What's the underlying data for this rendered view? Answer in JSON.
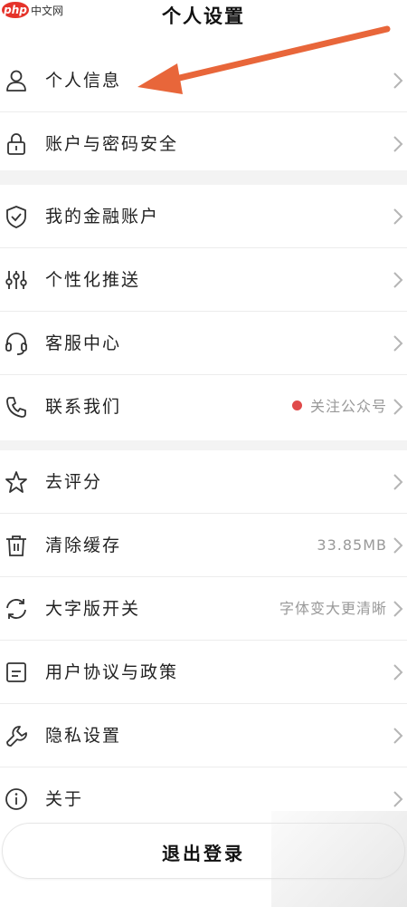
{
  "watermark": {
    "brand": "php",
    "site": "中文网"
  },
  "header": {
    "title": "个人设置"
  },
  "groups": [
    [
      {
        "label": "个人信息",
        "icon": "person-icon"
      },
      {
        "label": "账户与密码安全",
        "icon": "lock-icon"
      }
    ],
    [
      {
        "label": "我的金融账户",
        "icon": "shield-icon"
      },
      {
        "label": "个性化推送",
        "icon": "sliders-icon"
      },
      {
        "label": "客服中心",
        "icon": "headset-icon"
      },
      {
        "label": "联系我们",
        "icon": "phone-icon",
        "extra": "关注公众号",
        "dot_color": "#e04a4a"
      }
    ],
    [
      {
        "label": "去评分",
        "icon": "star-icon"
      },
      {
        "label": "清除缓存",
        "icon": "trash-icon",
        "extra": "33.85MB"
      },
      {
        "label": "大字版开关",
        "icon": "refresh-icon",
        "extra": "字体变大更清晰"
      },
      {
        "label": "用户协议与政策",
        "icon": "document-icon"
      },
      {
        "label": "隐私设置",
        "icon": "wrench-icon"
      },
      {
        "label": "关于",
        "icon": "info-icon"
      }
    ]
  ],
  "logout": {
    "label": "退出登录"
  },
  "colors": {
    "annotation_arrow": "#e8663a",
    "separator": "#f3f3f3",
    "chevron": "#b5b5b5"
  }
}
